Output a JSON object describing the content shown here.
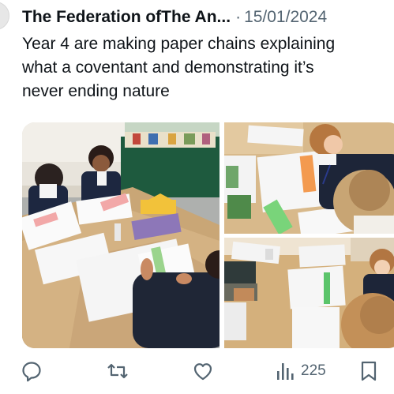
{
  "tweet": {
    "author": "The Federation ofThe An...",
    "separator": "·",
    "date": "15/01/2024",
    "text": "Year 4 are making paper chains explaining\nwhat a coventant and demonstrating it’s\nnever ending nature"
  },
  "media": {
    "photos": [
      "classroom-photo-main",
      "classroom-photo-top-right",
      "classroom-photo-bottom-right"
    ]
  },
  "actions": {
    "reply_icon": "reply-icon",
    "retweet_icon": "retweet-icon",
    "like_icon": "like-icon",
    "views_icon": "views-icon",
    "views_count": "225",
    "bookmark_icon": "bookmark-icon"
  }
}
